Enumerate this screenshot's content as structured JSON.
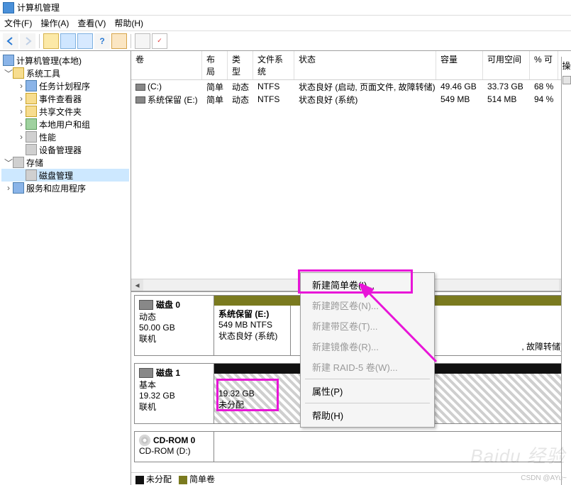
{
  "window": {
    "title": "计算机管理"
  },
  "menus": {
    "file": "文件(F)",
    "action": "操作(A)",
    "view": "查看(V)",
    "help": "帮助(H)"
  },
  "tree": {
    "root": "计算机管理(本地)",
    "system_tools": "系统工具",
    "task_scheduler": "任务计划程序",
    "event_viewer": "事件查看器",
    "shared_folders": "共享文件夹",
    "local_users": "本地用户和组",
    "performance": "性能",
    "device_manager": "设备管理器",
    "storage": "存储",
    "disk_mgmt": "磁盘管理",
    "services_apps": "服务和应用程序"
  },
  "columns": {
    "volume": "卷",
    "layout": "布局",
    "type": "类型",
    "fs": "文件系统",
    "status": "状态",
    "capacity": "容量",
    "free": "可用空间",
    "pct": "% 可",
    "actions": "操"
  },
  "volumes": [
    {
      "name": "(C:)",
      "layout": "简单",
      "type": "动态",
      "fs": "NTFS",
      "status": "状态良好 (启动, 页面文件, 故障转储)",
      "capacity": "49.46 GB",
      "free": "33.73 GB",
      "pct": "68 %"
    },
    {
      "name": "系统保留 (E:)",
      "layout": "简单",
      "type": "动态",
      "fs": "NTFS",
      "status": "状态良好 (系统)",
      "capacity": "549 MB",
      "free": "514 MB",
      "pct": "94 %"
    }
  ],
  "disks": {
    "d0": {
      "title": "磁盘 0",
      "kind": "动态",
      "size": "50.00 GB",
      "state": "联机",
      "p0": {
        "title": "系统保留  (E:)",
        "line2": "549 MB NTFS",
        "line3": "状态良好 (系统)"
      },
      "p1": {
        "line3": ", 故障转储)"
      }
    },
    "d1": {
      "title": "磁盘 1",
      "kind": "基本",
      "size": "19.32 GB",
      "state": "联机",
      "p0": {
        "line1": "19.32 GB",
        "line2": "未分配"
      }
    },
    "cd": {
      "title": "CD-ROM 0",
      "line2": "CD-ROM (D:)"
    }
  },
  "legend": {
    "unalloc": "未分配",
    "simple": "简单卷"
  },
  "ctx": {
    "new_simple": "新建简单卷(I)...",
    "new_span": "新建跨区卷(N)...",
    "new_stripe": "新建带区卷(T)...",
    "new_mirror": "新建镜像卷(R)...",
    "new_raid5": "新建 RAID-5 卷(W)...",
    "props": "属性(P)",
    "help": "帮助(H)"
  },
  "watermark": "Baidu 经验",
  "credit": "CSDN @AYu~"
}
